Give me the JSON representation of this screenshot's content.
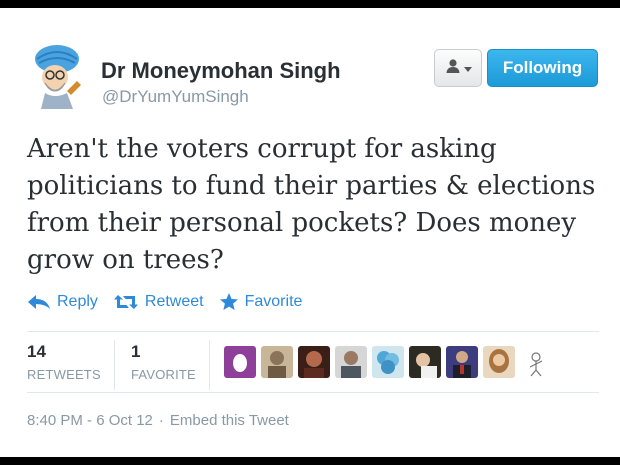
{
  "user": {
    "name": "Dr Moneymohan Singh",
    "handle": "@DrYumYumSingh",
    "avatar": "caricature-avatar"
  },
  "buttons": {
    "user_menu_icon": "user-dropdown-icon",
    "follow_label": "Following"
  },
  "tweet": {
    "lines": [
      "Aren't the voters corrupt for asking",
      "politicians to fund their parties & elections",
      "from their personal pockets? Does money",
      "grow on trees?"
    ]
  },
  "actions": {
    "reply": "Reply",
    "retweet": "Retweet",
    "favorite": "Favorite"
  },
  "stats": {
    "retweets_count": "14",
    "retweets_label": "RETWEETS",
    "favorites_count": "1",
    "favorites_label": "FAVORITE"
  },
  "faces": [
    "egg-avatar",
    "tan-portrait-avatar",
    "dark-portrait-avatar",
    "man-portrait-avatar",
    "blue-flower-avatar",
    "child-portrait-avatar",
    "suit-portrait-avatar",
    "woman-portrait-avatar",
    "sketch-avatar"
  ],
  "footer": {
    "timestamp": "8:40 PM - 6 Oct 12",
    "separator": "·",
    "embed": "Embed this Tweet"
  },
  "colors": {
    "link": "#2e8ad8",
    "follow_button": "#22a5e6",
    "muted_text": "#8899a6",
    "main_text": "#292f33"
  }
}
